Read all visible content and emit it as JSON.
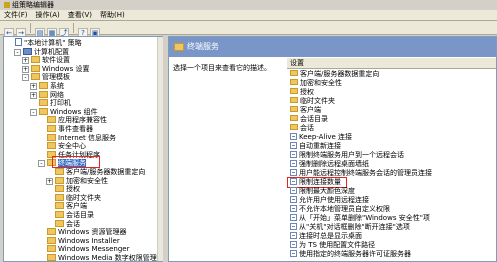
{
  "window": {
    "title": "组策略编辑器"
  },
  "menu": [
    "文件(F)",
    "操作(A)",
    "查看(V)",
    "帮助(H)"
  ],
  "toolbar": [
    "←",
    "→",
    "▤",
    "▦",
    "⤴",
    "?",
    "▣"
  ],
  "tree": [
    {
      "label": "\"本地计算机\" 策略",
      "indent": 0,
      "icon": "policy",
      "expander": ""
    },
    {
      "label": "计算机配置",
      "indent": 1,
      "icon": "computer",
      "expander": "-"
    },
    {
      "label": "软件设置",
      "indent": 2,
      "icon": "folder",
      "expander": "+"
    },
    {
      "label": "Windows 设置",
      "indent": 2,
      "icon": "folder",
      "expander": "+"
    },
    {
      "label": "管理模板",
      "indent": 2,
      "icon": "folder",
      "expander": "-"
    },
    {
      "label": "系统",
      "indent": 3,
      "icon": "folder",
      "expander": "+"
    },
    {
      "label": "网络",
      "indent": 3,
      "icon": "folder",
      "expander": "+"
    },
    {
      "label": "打印机",
      "indent": 3,
      "icon": "folder",
      "expander": ""
    },
    {
      "label": "Windows 组件",
      "indent": 3,
      "icon": "folder",
      "expander": "-"
    },
    {
      "label": "应用程序兼容性",
      "indent": 4,
      "icon": "folder",
      "expander": ""
    },
    {
      "label": "事件查看器",
      "indent": 4,
      "icon": "folder",
      "expander": ""
    },
    {
      "label": "Internet 信息服务",
      "indent": 4,
      "icon": "folder",
      "expander": ""
    },
    {
      "label": "安全中心",
      "indent": 4,
      "icon": "folder",
      "expander": ""
    },
    {
      "label": "任务计划程序",
      "indent": 4,
      "icon": "folder",
      "expander": ""
    },
    {
      "label": "终端服务",
      "indent": 4,
      "icon": "folder",
      "expander": "-",
      "selected": true
    },
    {
      "label": "客户端/服务器数据重定向",
      "indent": 5,
      "icon": "folder",
      "expander": ""
    },
    {
      "label": "加密和安全性",
      "indent": 5,
      "icon": "folder",
      "expander": "+"
    },
    {
      "label": "授权",
      "indent": 5,
      "icon": "folder",
      "expander": ""
    },
    {
      "label": "临时文件夹",
      "indent": 5,
      "icon": "folder",
      "expander": ""
    },
    {
      "label": "客户端",
      "indent": 5,
      "icon": "folder",
      "expander": ""
    },
    {
      "label": "会话目录",
      "indent": 5,
      "icon": "folder",
      "expander": ""
    },
    {
      "label": "会话",
      "indent": 5,
      "icon": "folder",
      "expander": ""
    },
    {
      "label": "Windows 资源管理器",
      "indent": 4,
      "icon": "folder",
      "expander": ""
    },
    {
      "label": "Windows Installer",
      "indent": 4,
      "icon": "folder",
      "expander": ""
    },
    {
      "label": "Windows Messenger",
      "indent": 4,
      "icon": "folder",
      "expander": ""
    },
    {
      "label": "Windows Media 数字权限管理",
      "indent": 4,
      "icon": "folder",
      "expander": ""
    }
  ],
  "right": {
    "header": "终端服务",
    "description": "选择一个项目来查看它的描述。",
    "column_header": "设置",
    "items": [
      {
        "label": "客户端/服务器数据重定向",
        "icon": "folder"
      },
      {
        "label": "加密和安全性",
        "icon": "folder"
      },
      {
        "label": "授权",
        "icon": "folder"
      },
      {
        "label": "临时文件夹",
        "icon": "folder"
      },
      {
        "label": "客户端",
        "icon": "folder"
      },
      {
        "label": "会话目录",
        "icon": "folder"
      },
      {
        "label": "会话",
        "icon": "folder"
      },
      {
        "label": "Keep-Alive 连接",
        "icon": "setting"
      },
      {
        "label": "自动重新连接",
        "icon": "setting"
      },
      {
        "label": "限制终端服务用户到一个远程会话",
        "icon": "setting"
      },
      {
        "label": "强制删除远程桌面墙纸",
        "icon": "setting"
      },
      {
        "label": "用户能远程控制终端服务会话的管理员连接",
        "icon": "setting"
      },
      {
        "label": "限制连接数量",
        "icon": "setting",
        "highlight": true
      },
      {
        "label": "限制最大颜色深度",
        "icon": "setting"
      },
      {
        "label": "允许用户使用远程连接",
        "icon": "setting"
      },
      {
        "label": "不允许本地管理员自定义权限",
        "icon": "setting"
      },
      {
        "label": "从「开始」菜单删除\"Windows 安全性\"项",
        "icon": "setting"
      },
      {
        "label": "从\"关机\"对话框删除\"断开连接\"选项",
        "icon": "setting"
      },
      {
        "label": "连接时总是显示桌面",
        "icon": "setting"
      },
      {
        "label": "为 TS 使用配置文件路径",
        "icon": "setting"
      },
      {
        "label": "使用指定的终端服务器许可证服务器",
        "icon": "setting"
      }
    ]
  },
  "colors": {
    "header_bg": "#7a96c9",
    "selected_bg": "#316ac5",
    "callout": "#e3261f"
  }
}
